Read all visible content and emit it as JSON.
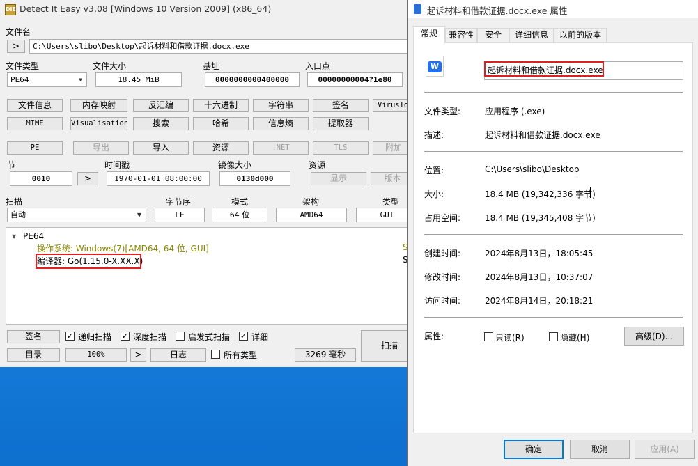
{
  "die": {
    "title": "Detect It Easy v3.08 [Windows 10 Version 2009] (x86_64)",
    "app_icon": "DiE",
    "file_name_label": "文件名",
    "browse_button": ">",
    "file_path": "C:\\Users\\slibo\\Desktop\\起诉材料和借款证据.docx.exe",
    "file_type_label": "文件类型",
    "file_type_value": "PE64",
    "file_size_label": "文件大小",
    "file_size_value": "18.45 MiB",
    "base_label": "基址",
    "base_value": "0000000000400000",
    "entry_label": "入口点",
    "entry_value": "00000000004?1e80",
    "row1_buttons": [
      "文件信息",
      "内存映射",
      "反汇编",
      "十六进制",
      "字符串",
      "签名",
      "VirusTo"
    ],
    "row2_buttons": [
      "MIME",
      "Visualisation",
      "搜索",
      "哈希",
      "信息熵",
      "提取器"
    ],
    "row3_buttons": [
      "PE",
      "导出",
      "导入",
      "资源",
      ".NET",
      "TLS",
      "附加"
    ],
    "section_label": "节",
    "section_value": "0010",
    "section_arrow": ">",
    "timestamp_label": "时间戳",
    "timestamp_value": "1970-01-01 08:00:00",
    "image_size_label": "镜像大小",
    "image_size_value": "0130d000",
    "resources_label": "资源",
    "resources_buttons": [
      "显示",
      "版本"
    ],
    "scan_label": "扫描",
    "scan_mode": "自动",
    "endian_label": "字节序",
    "endian_value": "LE",
    "mode_label": "模式",
    "mode_value": "64 位",
    "arch_label": "架构",
    "arch_value": "AMD64",
    "type_label": "类型",
    "type_value": "GUI",
    "tree": {
      "root": "PE64",
      "os": "操作系统: Windows(7)[AMD64, 64 位, GUI]",
      "compiler": "编译器: Go(1.15.0-X.XX.X)",
      "right_s1": "S",
      "right_s2": "S"
    },
    "bottom": {
      "signature_button": "签名",
      "recursive_scan": "递归扫描",
      "deep_scan": "深度扫描",
      "heuristic_scan": "启发式扫描",
      "verbose": "详细",
      "directory_button": "目录",
      "zoom": "100%",
      "zoom_arrow": ">",
      "log_button": "日志",
      "all_types": "所有类型",
      "time": "3269 毫秒",
      "scan_button": "扫描"
    }
  },
  "props": {
    "title": "起诉材料和借款证据.docx.exe 属性",
    "tabs": [
      "常规",
      "兼容性",
      "安全",
      "详细信息",
      "以前的版本"
    ],
    "file_name": "起诉材料和借款证据.docx.exe",
    "icon_letter": "W",
    "rows": {
      "type_label": "文件类型:",
      "type_value": "应用程序 (.exe)",
      "desc_label": "描述:",
      "desc_value": "起诉材料和借款证据.docx.exe",
      "location_label": "位置:",
      "location_value": "C:\\Users\\slibo\\Desktop",
      "size_label": "大小:",
      "size_value": "18.4 MB (19,342,336 字节)",
      "disk_label": "占用空间:",
      "disk_value": "18.4 MB (19,345,408 字节)",
      "created_label": "创建时间:",
      "created_value": "2024年8月13日，18:05:45",
      "modified_label": "修改时间:",
      "modified_value": "2024年8月13日，10:37:07",
      "accessed_label": "访问时间:",
      "accessed_value": "2024年8月14日，20:18:21",
      "attr_label": "属性:",
      "readonly_label": "只读(R)",
      "hidden_label": "隐藏(H)",
      "advanced_button": "高级(D)..."
    },
    "buttons": {
      "ok": "确定",
      "cancel": "取消",
      "apply": "应用(A)"
    }
  },
  "colors": {
    "highlight_box": "#e02020",
    "tree_text": "#8a8a00",
    "desktop": "#1f8ae6"
  }
}
